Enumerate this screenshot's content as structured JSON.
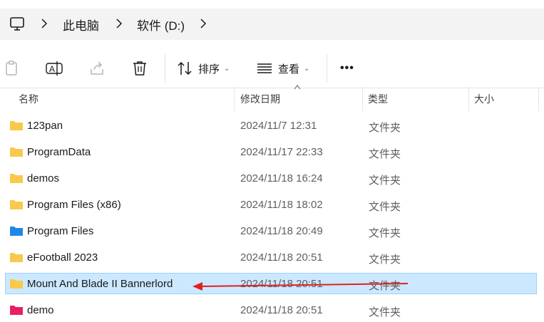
{
  "breadcrumb": {
    "items": [
      "此电脑",
      "软件 (D:)"
    ]
  },
  "toolbar": {
    "sort_label": "排序",
    "view_label": "查看",
    "more_label": "•••"
  },
  "columns": {
    "name": "名称",
    "date": "修改日期",
    "type": "类型",
    "size": "大小"
  },
  "files": [
    {
      "name": "123pan",
      "date": "2024/11/7 12:31",
      "type": "文件夹",
      "icon": "folder-yellow",
      "color": "#f8c94a"
    },
    {
      "name": "ProgramData",
      "date": "2024/11/17 22:33",
      "type": "文件夹",
      "icon": "folder-yellow",
      "color": "#f8c94a"
    },
    {
      "name": "demos",
      "date": "2024/11/18 16:24",
      "type": "文件夹",
      "icon": "folder-yellow",
      "color": "#f8c94a"
    },
    {
      "name": "Program Files (x86)",
      "date": "2024/11/18 18:02",
      "type": "文件夹",
      "icon": "folder-yellow",
      "color": "#f8c94a"
    },
    {
      "name": "Program Files",
      "date": "2024/11/18 20:49",
      "type": "文件夹",
      "icon": "folder-blue",
      "color": "#1e88e5"
    },
    {
      "name": "eFootball 2023",
      "date": "2024/11/18 20:51",
      "type": "文件夹",
      "icon": "folder-yellow",
      "color": "#f8c94a"
    },
    {
      "name": "Mount And Blade II Bannerlord",
      "date": "2024/11/18 20:51",
      "type": "文件夹",
      "icon": "folder-yellow",
      "color": "#f8c94a",
      "selected": true
    },
    {
      "name": "demo",
      "date": "2024/11/18 20:51",
      "type": "文件夹",
      "icon": "folder-pink",
      "color": "#e91e63"
    }
  ],
  "colors": {
    "selection_bg": "#cce8ff",
    "selection_border": "#99d1ff",
    "annotation_arrow": "#e02020"
  }
}
